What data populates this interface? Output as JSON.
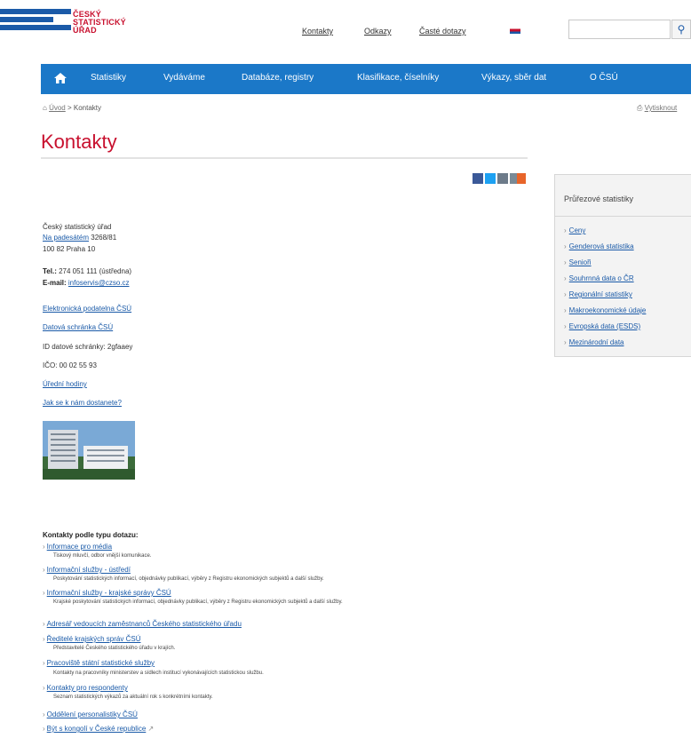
{
  "header": {
    "logo_lines": [
      "ČESKÝ",
      "STATISTICKÝ",
      "ÚŘAD"
    ],
    "top_links": [
      "Kontakty",
      "Odkazy",
      "Časté dotazy"
    ],
    "lang_label": "EN",
    "search_placeholder": ""
  },
  "nav": {
    "items": [
      "Statistiky",
      "Vydáváme",
      "Databáze, registry",
      "Klasifikace, číselníky",
      "Výkazy, sběr dat",
      "O ČSÚ"
    ]
  },
  "breadcrumb": {
    "home": "Úvod",
    "sep": "> Kontakty",
    "print": "Vytisknout"
  },
  "page": {
    "title": "Kontakty"
  },
  "contact": {
    "org": "Český statistický úřad",
    "street_link": "Na padesátém",
    "street_rest": " 3268/81",
    "city": "100 82 Praha 10",
    "tel_label": "Tel.:",
    "tel_value": " 274 051 111 (ústředna)",
    "email_label": "E-mail:",
    "email_value": "infoservis@czso.cz",
    "links": [
      "Elektronická podatelna ČSÚ",
      "Datová schránka ČSÚ"
    ],
    "id_ds": "ID datové schránky: 2gfaaey",
    "ico": "IČO: 00 02 55 93",
    "links2": [
      "Úřední hodiny",
      "Jak se k nám dostanete?"
    ]
  },
  "sidebar": {
    "title": "Průřezové statistiky",
    "items": [
      "Ceny",
      "Genderová statistika",
      "Senioři",
      "Souhrnná data o ČR",
      "Regionální statistiky",
      "Makroekonomické údaje",
      "Evropská data (ESDS)",
      "Mezinárodní data"
    ]
  },
  "types": {
    "title": "Kontakty podle typu dotazu:",
    "items": [
      {
        "label": "Informace pro média",
        "desc": "Tiskový mluvčí, odbor vnější komunikace."
      },
      {
        "label": "Informační služby - ústředí",
        "desc": "Poskytování statistických informací, objednávky publikací, výběry z Registru ekonomických subjektů a další služby."
      },
      {
        "label": "Informační služby - krajské správy ČSÚ",
        "desc": "Krajské poskytování statistických informací, objednávky publikací, výběry z Registru ekonomických subjektů a další služby."
      },
      {
        "label": "Adresář vedoucích zaměstnanců Českého statistického úřadu",
        "desc": ""
      },
      {
        "label": "Ředitelé krajských správ ČSÚ",
        "desc": "Představitelé Českého statistického úřadu v krajích."
      },
      {
        "label": "Pracoviště státní statistické služby",
        "desc": "Kontakty na pracovníky ministerstev a sídlech institucí vykonávajících statistickou službu."
      },
      {
        "label": "Kontakty pro respondenty",
        "desc": "Seznam statistických výkazů za aktuální rok s konkrétními kontakty."
      },
      {
        "label": "Oddělení personalistiky ČSÚ",
        "desc": ""
      },
      {
        "label": "Být s kongolí v České republice",
        "desc": ""
      }
    ]
  },
  "colors": {
    "brand_blue": "#1b78c8",
    "brand_red": "#c8102e",
    "link": "#1a5aa8"
  }
}
